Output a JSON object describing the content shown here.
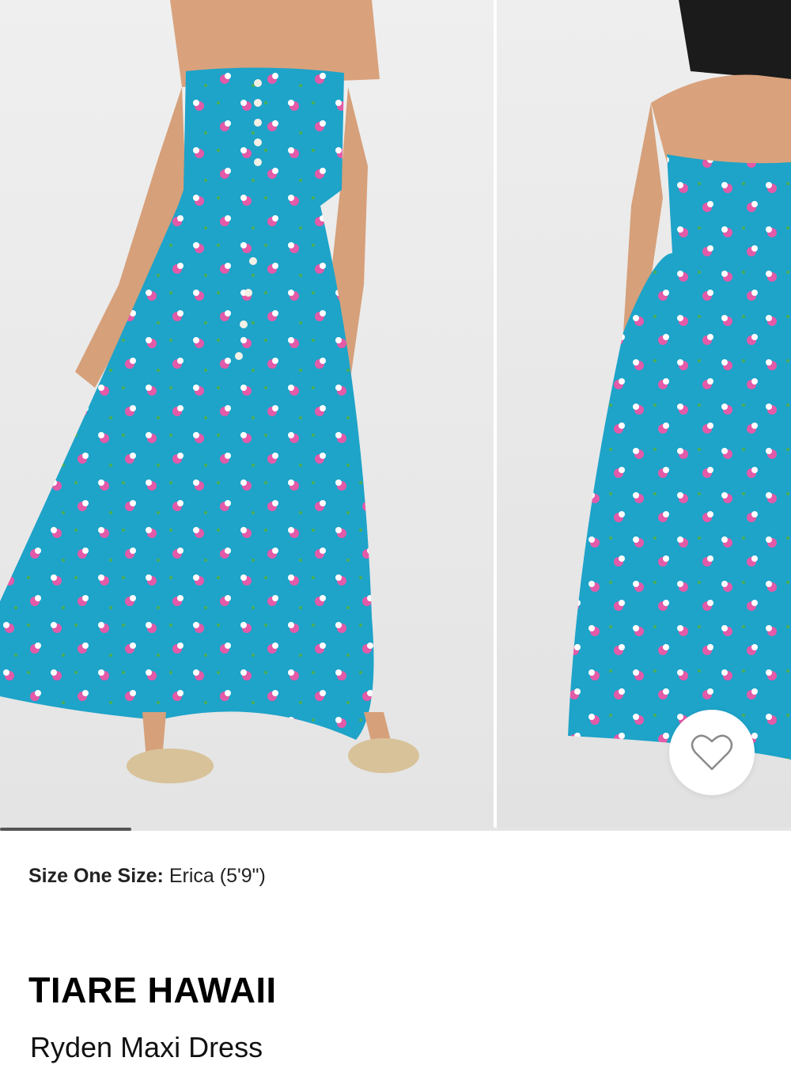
{
  "gallery": {
    "images": [
      {
        "icon": "product-photo-front"
      },
      {
        "icon": "product-photo-back"
      }
    ],
    "favorite": {
      "icon": "heart-outline-icon"
    },
    "dress_color": "#1ea3c9",
    "print_color": "#e35aa8"
  },
  "model_info": {
    "size_label": "Size One Size:",
    "model": "Erica (5'9\")"
  },
  "product": {
    "brand": "TIARE HAWAII",
    "name": "Ryden Maxi Dress"
  }
}
